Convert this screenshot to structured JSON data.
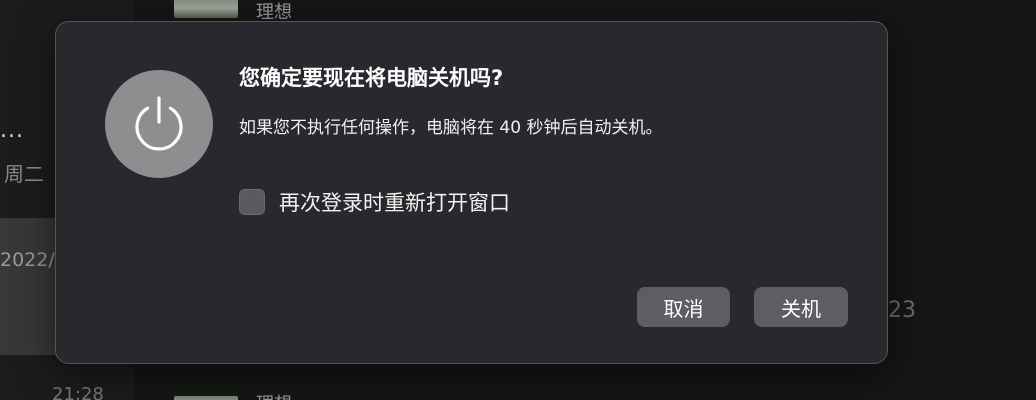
{
  "background": {
    "ellipsis": "...",
    "weekday": "周二",
    "date": "2022/",
    "time": "21:28",
    "title_top": "理想",
    "title_bottom": "理想",
    "number": "23"
  },
  "dialog": {
    "icon": "power-icon",
    "title": "您确定要现在将电脑关机吗?",
    "message": "如果您不执行任何操作，电脑将在 40 秒钟后自动关机。",
    "reopen_windows_label": "再次登录时重新打开窗口",
    "reopen_windows_checked": false,
    "cancel_label": "取消",
    "shutdown_label": "关机"
  },
  "colors": {
    "dialog_background": "#29282d",
    "button_background": "#5e5d62",
    "power_badge": "#8e8e90"
  }
}
